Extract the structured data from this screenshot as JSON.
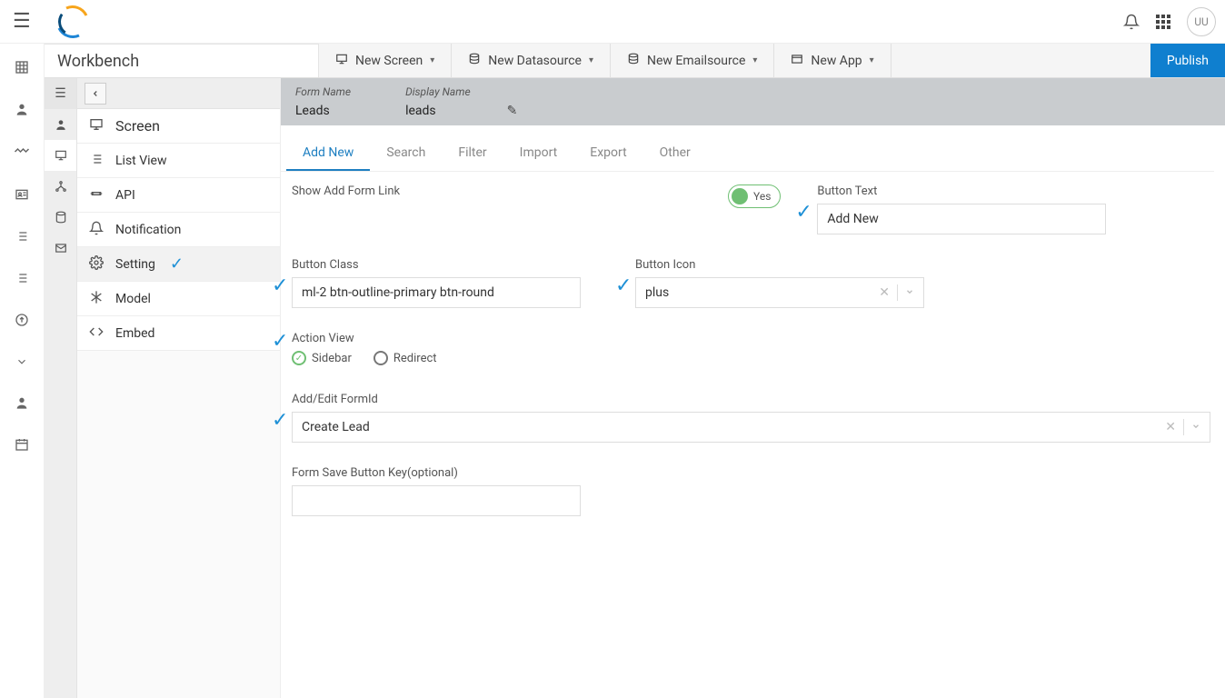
{
  "top": {
    "avatar": "UU"
  },
  "wb": {
    "title": "Workbench",
    "btn_new_screen": "New Screen",
    "btn_new_datasource": "New Datasource",
    "btn_new_emailsource": "New Emailsource",
    "btn_new_app": "New App",
    "btn_publish": "Publish"
  },
  "sidenav": {
    "screen": "Screen",
    "listview": "List View",
    "api": "API",
    "notification": "Notification",
    "setting": "Setting",
    "model": "Model",
    "embed": "Embed"
  },
  "crumb": {
    "form_name_label": "Form Name",
    "form_name_value": "Leads",
    "display_name_label": "Display Name",
    "display_name_value": "leads"
  },
  "tabs": {
    "addnew": "Add New",
    "search": "Search",
    "filter": "Filter",
    "import": "Import",
    "export": "Export",
    "other": "Other"
  },
  "form": {
    "show_add_form_link": "Show Add Form Link",
    "toggle_yes": "Yes",
    "button_text_label": "Button Text",
    "button_text_value": "Add New",
    "button_class_label": "Button Class",
    "button_class_value": "ml-2 btn-outline-primary btn-round",
    "button_icon_label": "Button Icon",
    "button_icon_value": "plus",
    "action_view_label": "Action View",
    "radio_sidebar": "Sidebar",
    "radio_redirect": "Redirect",
    "add_edit_formid_label": "Add/Edit FormId",
    "add_edit_formid_value": "Create Lead",
    "form_save_button_key_label": "Form Save Button Key(optional)"
  }
}
